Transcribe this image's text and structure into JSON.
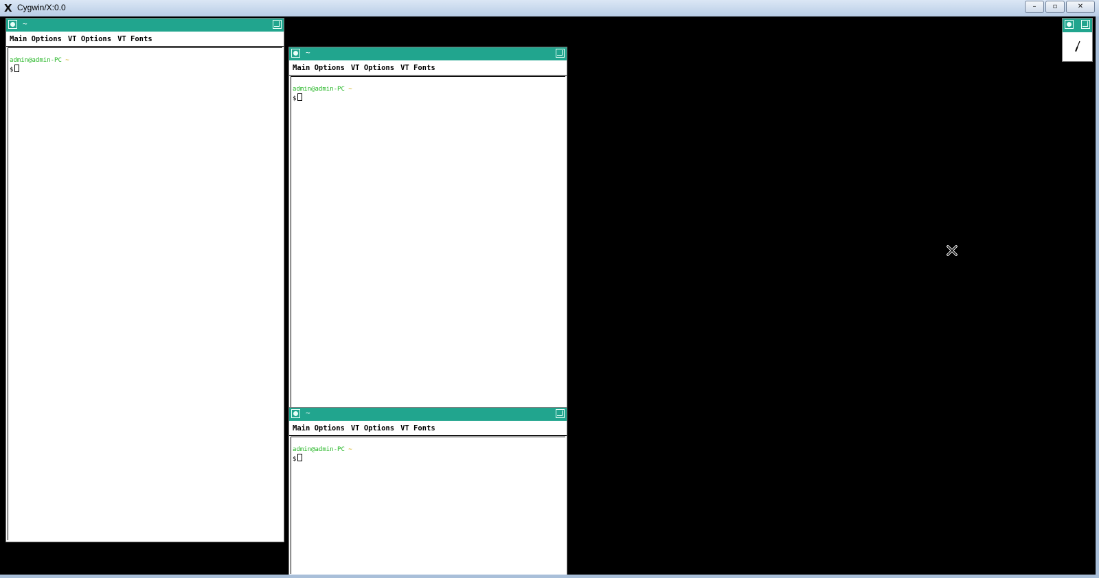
{
  "window": {
    "title": "Cygwin/X:0.0",
    "logo": "X",
    "controls": {
      "minimize": "–",
      "maximize": "▫",
      "close": "✕"
    }
  },
  "terminals": [
    {
      "title": "~",
      "menu": [
        "Main Options",
        "VT Options",
        "VT Fonts"
      ],
      "prompt_user": "admin@admin-PC",
      "prompt_dir": "~",
      "prompt_symbol": "$"
    },
    {
      "title": "~",
      "menu": [
        "Main Options",
        "VT Options",
        "VT Fonts"
      ],
      "prompt_user": "admin@admin-PC",
      "prompt_dir": "~",
      "prompt_symbol": "$"
    },
    {
      "title": "~",
      "menu": [
        "Main Options",
        "VT Options",
        "VT Fonts"
      ],
      "prompt_user": "admin@admin-PC",
      "prompt_dir": "~",
      "prompt_symbol": "$"
    }
  ],
  "colors": {
    "titlebar": "#21a58e",
    "prompt_user": "#22b522",
    "prompt_dir": "#c9a700",
    "desktop": "#000000"
  },
  "icons": {
    "window_menu": "circle-button-icon",
    "resize": "resize-corner-icon",
    "cursor": "x-cursor-icon",
    "clock": "analog-clock-icon"
  }
}
